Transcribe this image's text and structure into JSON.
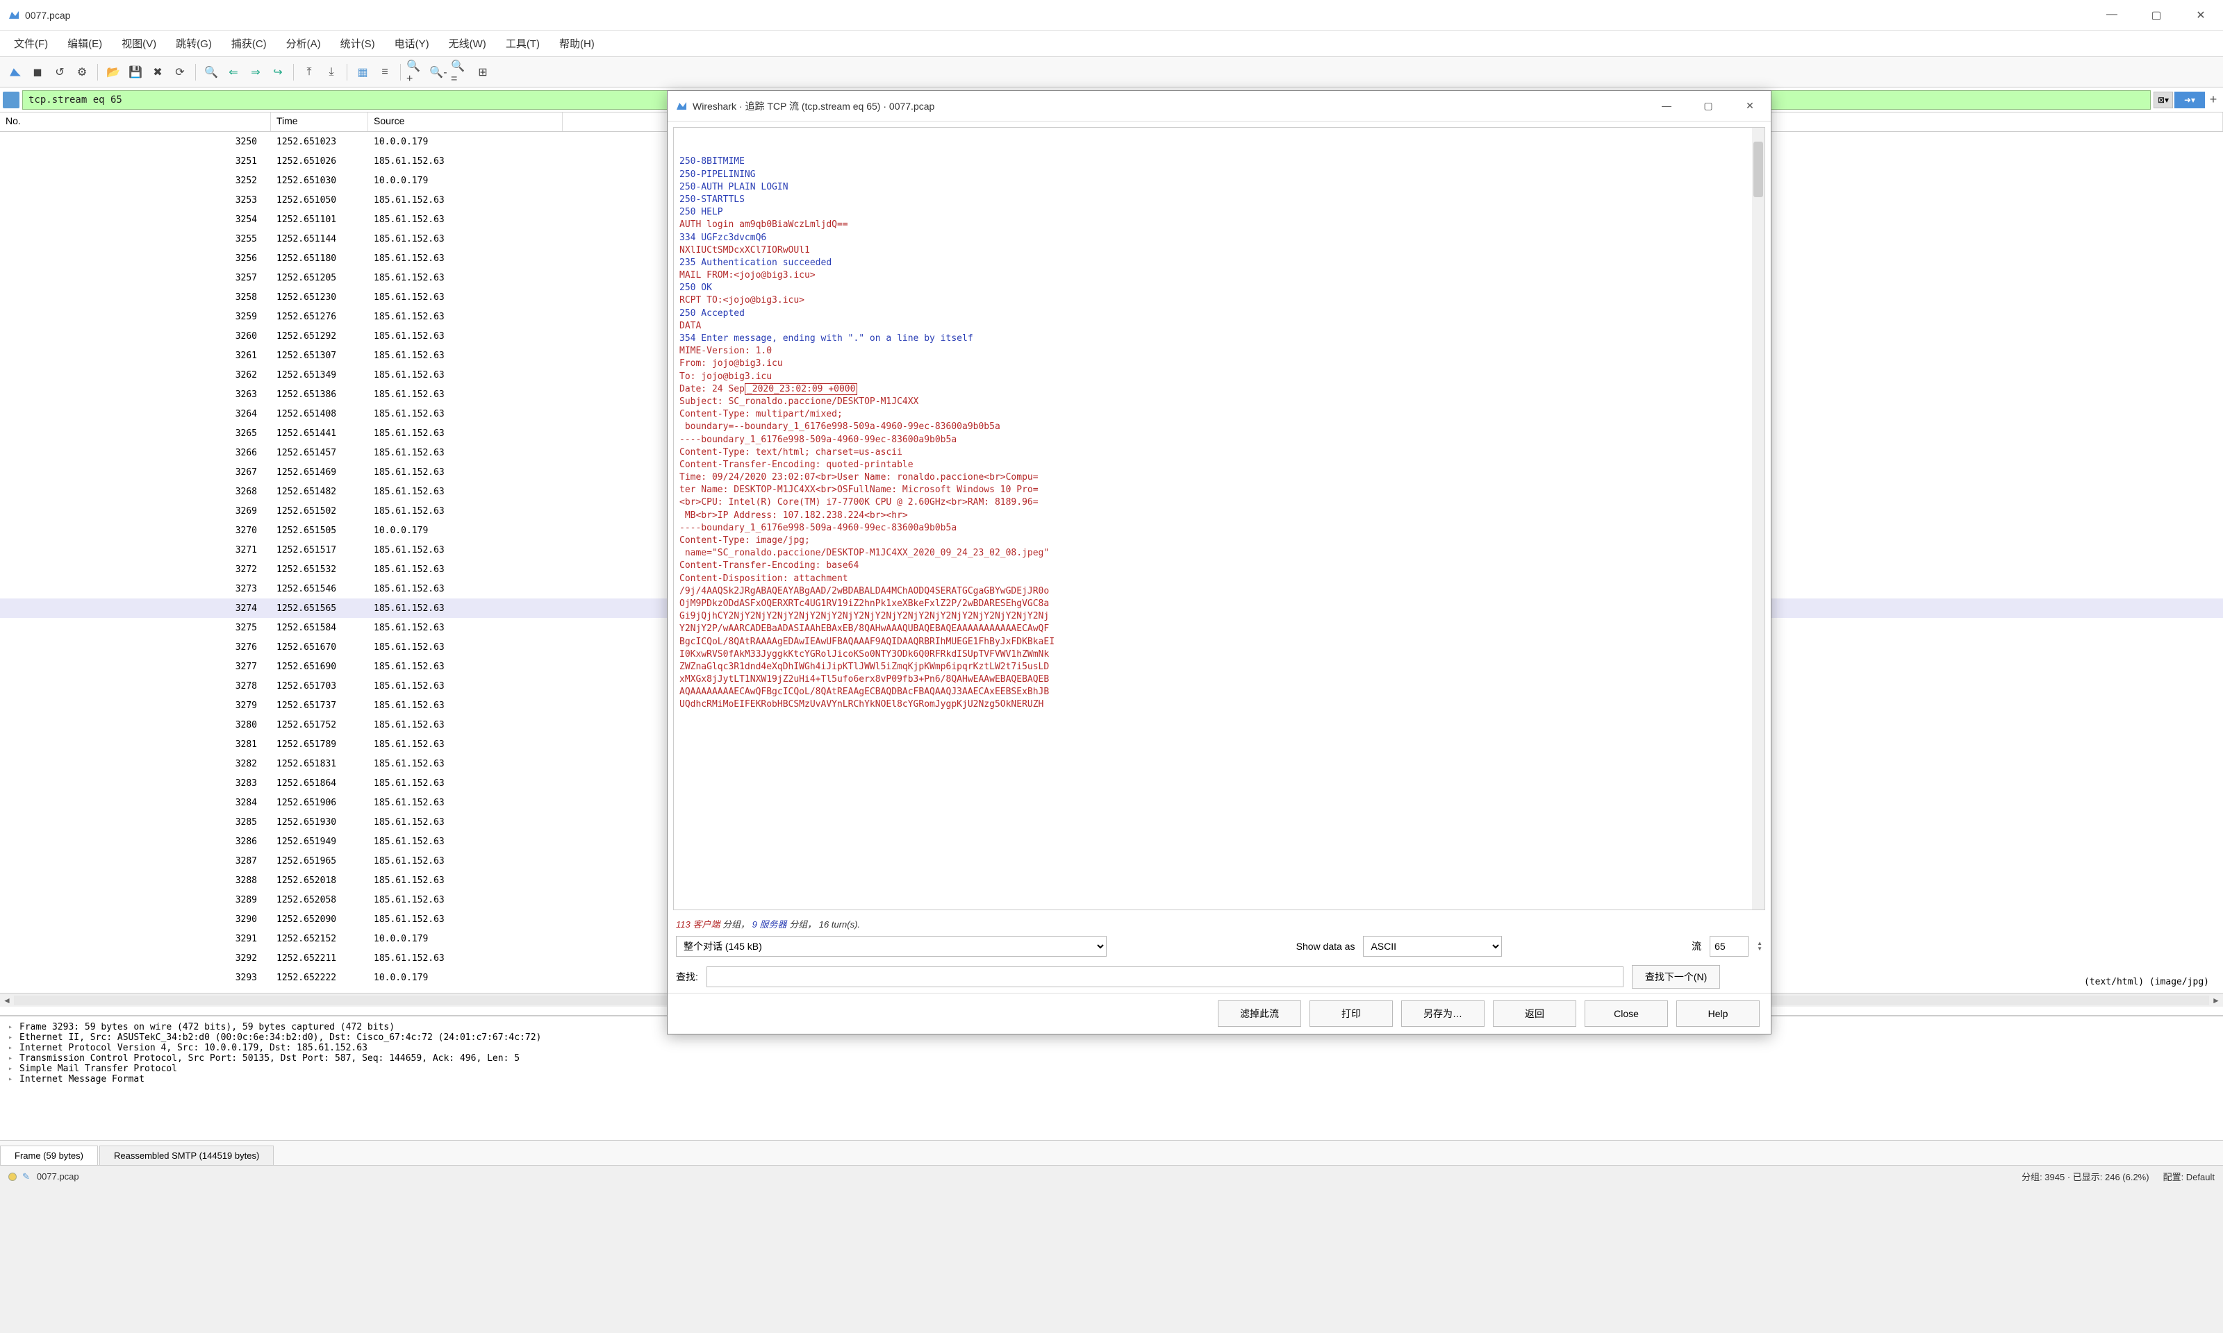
{
  "window": {
    "title": "0077.pcap",
    "controls": {
      "min": "—",
      "max": "▢",
      "close": "✕"
    }
  },
  "menubar": [
    "文件(F)",
    "编辑(E)",
    "视图(V)",
    "跳转(G)",
    "捕获(C)",
    "分析(A)",
    "统计(S)",
    "电话(Y)",
    "无线(W)",
    "工具(T)",
    "帮助(H)"
  ],
  "filter": {
    "value": "tcp.stream eq 65"
  },
  "packet_headers": {
    "no": "No.",
    "time": "Time",
    "src": "Source"
  },
  "packets": [
    {
      "no": "3250",
      "time": "1252.651023",
      "src": "10.0.0.179"
    },
    {
      "no": "3251",
      "time": "1252.651026",
      "src": "185.61.152.63"
    },
    {
      "no": "3252",
      "time": "1252.651030",
      "src": "10.0.0.179"
    },
    {
      "no": "3253",
      "time": "1252.651050",
      "src": "185.61.152.63"
    },
    {
      "no": "3254",
      "time": "1252.651101",
      "src": "185.61.152.63"
    },
    {
      "no": "3255",
      "time": "1252.651144",
      "src": "185.61.152.63"
    },
    {
      "no": "3256",
      "time": "1252.651180",
      "src": "185.61.152.63"
    },
    {
      "no": "3257",
      "time": "1252.651205",
      "src": "185.61.152.63"
    },
    {
      "no": "3258",
      "time": "1252.651230",
      "src": "185.61.152.63"
    },
    {
      "no": "3259",
      "time": "1252.651276",
      "src": "185.61.152.63"
    },
    {
      "no": "3260",
      "time": "1252.651292",
      "src": "185.61.152.63"
    },
    {
      "no": "3261",
      "time": "1252.651307",
      "src": "185.61.152.63"
    },
    {
      "no": "3262",
      "time": "1252.651349",
      "src": "185.61.152.63"
    },
    {
      "no": "3263",
      "time": "1252.651386",
      "src": "185.61.152.63"
    },
    {
      "no": "3264",
      "time": "1252.651408",
      "src": "185.61.152.63"
    },
    {
      "no": "3265",
      "time": "1252.651441",
      "src": "185.61.152.63"
    },
    {
      "no": "3266",
      "time": "1252.651457",
      "src": "185.61.152.63"
    },
    {
      "no": "3267",
      "time": "1252.651469",
      "src": "185.61.152.63"
    },
    {
      "no": "3268",
      "time": "1252.651482",
      "src": "185.61.152.63"
    },
    {
      "no": "3269",
      "time": "1252.651502",
      "src": "185.61.152.63"
    },
    {
      "no": "3270",
      "time": "1252.651505",
      "src": "10.0.0.179"
    },
    {
      "no": "3271",
      "time": "1252.651517",
      "src": "185.61.152.63"
    },
    {
      "no": "3272",
      "time": "1252.651532",
      "src": "185.61.152.63"
    },
    {
      "no": "3273",
      "time": "1252.651546",
      "src": "185.61.152.63"
    },
    {
      "no": "3274",
      "time": "1252.651565",
      "src": "185.61.152.63",
      "sel": true
    },
    {
      "no": "3275",
      "time": "1252.651584",
      "src": "185.61.152.63"
    },
    {
      "no": "3276",
      "time": "1252.651670",
      "src": "185.61.152.63"
    },
    {
      "no": "3277",
      "time": "1252.651690",
      "src": "185.61.152.63"
    },
    {
      "no": "3278",
      "time": "1252.651703",
      "src": "185.61.152.63"
    },
    {
      "no": "3279",
      "time": "1252.651737",
      "src": "185.61.152.63"
    },
    {
      "no": "3280",
      "time": "1252.651752",
      "src": "185.61.152.63"
    },
    {
      "no": "3281",
      "time": "1252.651789",
      "src": "185.61.152.63"
    },
    {
      "no": "3282",
      "time": "1252.651831",
      "src": "185.61.152.63"
    },
    {
      "no": "3283",
      "time": "1252.651864",
      "src": "185.61.152.63"
    },
    {
      "no": "3284",
      "time": "1252.651906",
      "src": "185.61.152.63"
    },
    {
      "no": "3285",
      "time": "1252.651930",
      "src": "185.61.152.63"
    },
    {
      "no": "3286",
      "time": "1252.651949",
      "src": "185.61.152.63"
    },
    {
      "no": "3287",
      "time": "1252.651965",
      "src": "185.61.152.63"
    },
    {
      "no": "3288",
      "time": "1252.652018",
      "src": "185.61.152.63"
    },
    {
      "no": "3289",
      "time": "1252.652058",
      "src": "185.61.152.63"
    },
    {
      "no": "3290",
      "time": "1252.652090",
      "src": "185.61.152.63"
    },
    {
      "no": "3291",
      "time": "1252.652152",
      "src": "10.0.0.179"
    },
    {
      "no": "3292",
      "time": "1252.652211",
      "src": "185.61.152.63"
    },
    {
      "no": "3293",
      "time": "1252.652222",
      "src": "10.0.0.179"
    }
  ],
  "info_tail": "(text/html) (image/jpg)",
  "detail_lines": [
    "Frame 3293: 59 bytes on wire (472 bits), 59 bytes captured (472 bits)",
    "Ethernet II, Src: ASUSTekC_34:b2:d0 (00:0c:6e:34:b2:d0), Dst: Cisco_67:4c:72 (24:01:c7:67:4c:72)",
    "Internet Protocol Version 4, Src: 10.0.0.179, Dst: 185.61.152.63",
    "Transmission Control Protocol, Src Port: 50135, Dst Port: 587, Seq: 144659, Ack: 496, Len: 5",
    "Simple Mail Transfer Protocol",
    "Internet Message Format"
  ],
  "bottom_tabs": {
    "frame": "Frame (59 bytes)",
    "smtp": "Reassembled SMTP (144519 bytes)"
  },
  "statusbar": {
    "file": "0077.pcap",
    "packets": "分组: 3945 · 已显示: 246 (6.2%)",
    "profile": "配置: Default"
  },
  "dialog": {
    "title": "Wireshark · 追踪 TCP 流 (tcp.stream eq 65) · 0077.pcap",
    "stream_lines": [
      {
        "c": "server",
        "t": "250-8BITMIME"
      },
      {
        "c": "server",
        "t": "250-PIPELINING"
      },
      {
        "c": "server",
        "t": "250-AUTH PLAIN LOGIN"
      },
      {
        "c": "server",
        "t": "250-STARTTLS"
      },
      {
        "c": "server",
        "t": "250 HELP"
      },
      {
        "c": "client",
        "t": "AUTH login am9qb0BiaWczLmljdQ=="
      },
      {
        "c": "server",
        "t": "334 UGFzc3dvcmQ6"
      },
      {
        "c": "client",
        "t": "NXlIUCtSMDcxXCl7IORwOUl1"
      },
      {
        "c": "server",
        "t": "235 Authentication succeeded"
      },
      {
        "c": "client",
        "t": "MAIL FROM:<jojo@big3.icu>"
      },
      {
        "c": "server",
        "t": "250 OK"
      },
      {
        "c": "client",
        "t": "RCPT TO:<jojo@big3.icu>"
      },
      {
        "c": "server",
        "t": "250 Accepted"
      },
      {
        "c": "client",
        "t": "DATA"
      },
      {
        "c": "server",
        "t": "354 Enter message, ending with \".\" on a line by itself"
      },
      {
        "c": "client",
        "t": "MIME-Version: 1.0"
      },
      {
        "c": "client",
        "t": "From: jojo@big3.icu"
      },
      {
        "c": "client",
        "t": "To: jojo@big3.icu"
      },
      {
        "c": "client",
        "hl": "_2020_23:02:09 +0000",
        "pre": "Date: 24 Sep"
      },
      {
        "c": "client",
        "t": "Subject: SC_ronaldo.paccione/DESKTOP-M1JC4XX"
      },
      {
        "c": "client",
        "t": "Content-Type: multipart/mixed;"
      },
      {
        "c": "client",
        "t": " boundary=--boundary_1_6176e998-509a-4960-99ec-83600a9b0b5a"
      },
      {
        "c": "client",
        "t": ""
      },
      {
        "c": "client",
        "t": ""
      },
      {
        "c": "client",
        "t": "----boundary_1_6176e998-509a-4960-99ec-83600a9b0b5a"
      },
      {
        "c": "client",
        "t": "Content-Type: text/html; charset=us-ascii"
      },
      {
        "c": "client",
        "t": "Content-Transfer-Encoding: quoted-printable"
      },
      {
        "c": "client",
        "t": ""
      },
      {
        "c": "client",
        "t": "Time: 09/24/2020 23:02:07<br>User Name: ronaldo.paccione<br>Compu="
      },
      {
        "c": "client",
        "t": "ter Name: DESKTOP-M1JC4XX<br>OSFullName: Microsoft Windows 10 Pro="
      },
      {
        "c": "client",
        "t": "<br>CPU: Intel(R) Core(TM) i7-7700K CPU @ 2.60GHz<br>RAM: 8189.96="
      },
      {
        "c": "client",
        "t": " MB<br>IP Address: 107.182.238.224<br><hr>"
      },
      {
        "c": "client",
        "t": "----boundary_1_6176e998-509a-4960-99ec-83600a9b0b5a"
      },
      {
        "c": "client",
        "t": "Content-Type: image/jpg;"
      },
      {
        "c": "client",
        "t": " name=\"SC_ronaldo.paccione/DESKTOP-M1JC4XX_2020_09_24_23_02_08.jpeg\""
      },
      {
        "c": "client",
        "t": "Content-Transfer-Encoding: base64"
      },
      {
        "c": "client",
        "t": "Content-Disposition: attachment"
      },
      {
        "c": "client",
        "t": ""
      },
      {
        "c": "client",
        "t": "/9j/4AAQSk2JRgABAQEAYABgAAD/2wBDABALDA4MChAODQ4SERATGCgaGBYwGDEjJR0o"
      },
      {
        "c": "client",
        "t": "OjM9PDkzODdASFxOQERXRTc4UG1RV19iZ2hnPk1xeXBkeFxlZ2P/2wBDARESEhgVGC8a"
      },
      {
        "c": "client",
        "t": "Gi9jQjhCY2NjY2NjY2NjY2NjY2NjY2NjY2NjY2NjY2NjY2NjY2NjY2NjY2NjY2NjY2Nj"
      },
      {
        "c": "client",
        "t": "Y2NjY2P/wAARCADEBaADASIAAhEBAxEB/8QAHwAAAQUBAQEBAQEAAAAAAAAAAAECAwQF"
      },
      {
        "c": "client",
        "t": "BgcICQoL/8QAtRAAAAgEDAwIEAwUFBAQAAAF9AQIDAAQRBRIhMUEGE1FhByJxFDKBkaEI"
      },
      {
        "c": "client",
        "t": "I0KxwRVS0fAkM33JyggkKtcYGRolJicoKSo0NTY3ODk6Q0RFRkdISUpTVFVWV1hZWmNk"
      },
      {
        "c": "client",
        "t": "ZWZnaGlqc3R1dnd4eXqDhIWGh4iJipKTlJWWl5iZmqKjpKWmp6ipqrKztLW2t7i5usLD"
      },
      {
        "c": "client",
        "t": "xMXGx8jJytLT1NXW19jZ2uHi4+Tl5ufo6erx8vP09fb3+Pn6/8QAHwEAAwEBAQEBAQEB"
      },
      {
        "c": "client",
        "t": "AQAAAAAAAAECAwQFBgcICQoL/8QAtREAAgECBAQDBAcFBAQAAQJ3AAECAxEEBSExBhJB"
      },
      {
        "c": "client",
        "t": "UQdhcRMiMoEIFEKRobHBCSMzUvAVYnLRChYkNOEl8cYGRomJygpKjU2Nzg5OkNERUZH"
      }
    ],
    "summary": {
      "n_client": "113",
      "client_label": "客户端",
      "mid1": "分组，",
      "n_server": "9",
      "server_label": "服务器",
      "mid2": "分组，",
      "turns": "16 turn(s)."
    },
    "conv_select": "整个对话 (145 kB)",
    "show_as_label": "Show data as",
    "show_as_value": "ASCII",
    "stream_label": "流",
    "stream_value": "65",
    "find_label": "查找:",
    "find_value": "",
    "find_next": "查找下一个(N)",
    "buttons": {
      "filter_out": "滤掉此流",
      "print": "打印",
      "save_as": "另存为…",
      "back": "返回",
      "close": "Close",
      "help": "Help"
    }
  }
}
